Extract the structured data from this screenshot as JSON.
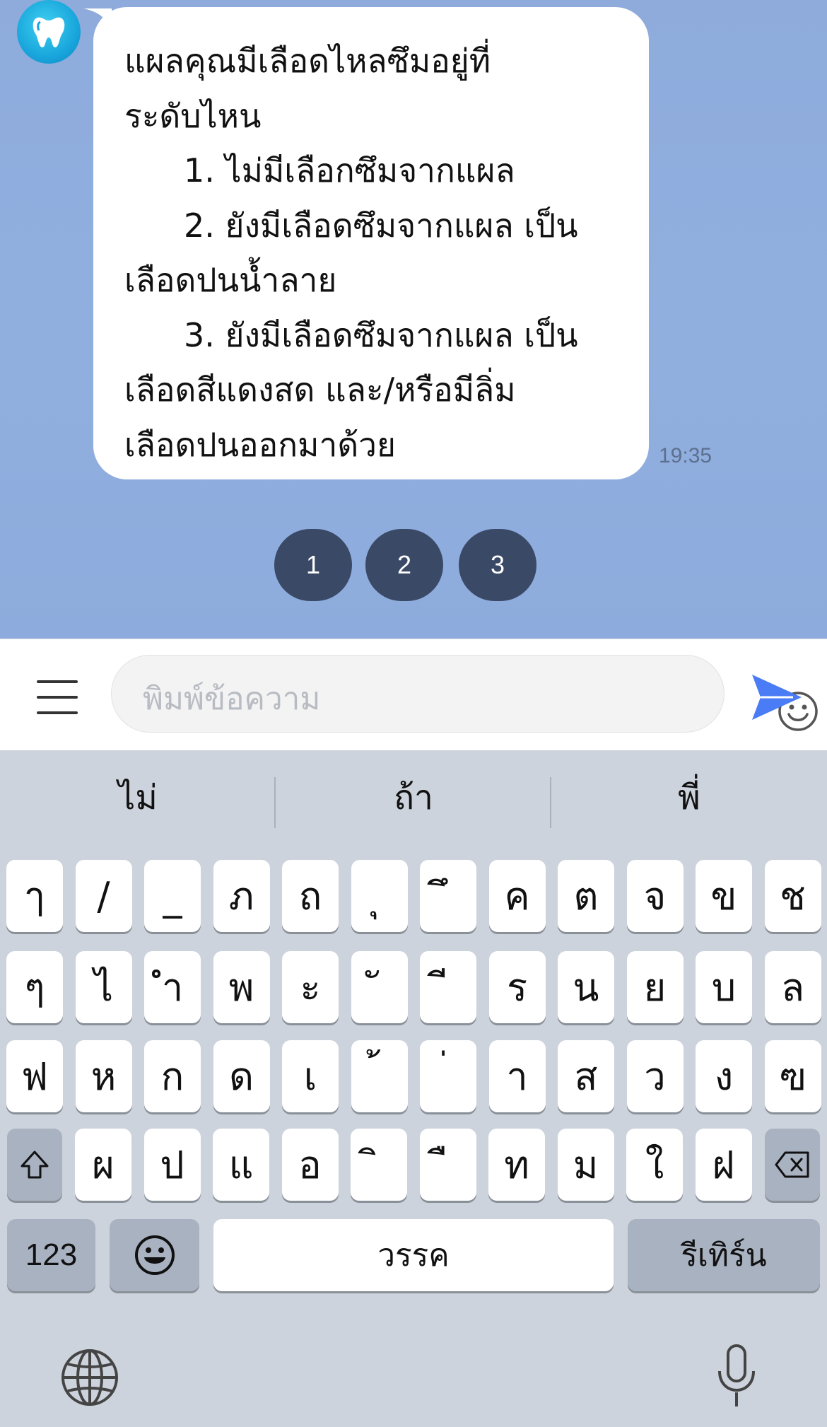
{
  "chat": {
    "message_lines": [
      {
        "text": "แผลคุณมีเลือดไหลซึมอยู่ที่",
        "indent": false
      },
      {
        "text": "ระดับไหน",
        "indent": false
      },
      {
        "text": "1. ไม่มีเลือกซึมจากแผล",
        "indent": true
      },
      {
        "text": "2. ยังมีเลือดซึมจากแผล เป็น",
        "indent": true
      },
      {
        "text": "เลือดปนน้ำลาย",
        "indent": false
      },
      {
        "text": "3. ยังมีเลือดซึมจากแผล เป็น",
        "indent": true
      },
      {
        "text": "เลือดสีแดงสด และ/หรือมีลิ่ม",
        "indent": false
      },
      {
        "text": "เลือดปนออกมาด้วย",
        "indent": false
      }
    ],
    "timestamp": "19:35",
    "quick_replies": [
      "1",
      "2",
      "3"
    ],
    "avatar_icon": "tooth-logo-icon"
  },
  "input": {
    "placeholder": "พิมพ์ข้อความ",
    "menu_icon": "hamburger-menu-icon",
    "emoji_icon": "smiley-icon",
    "send_icon": "send-arrow-icon"
  },
  "keyboard": {
    "suggestions": [
      "ไม่",
      "ถ้า",
      "พี่"
    ],
    "row1": [
      "ๅ",
      "/",
      "_",
      "ภ",
      "ถ",
      "ุ",
      "ึ",
      "ค",
      "ต",
      "จ",
      "ข",
      "ช"
    ],
    "row2": [
      "ๆ",
      "ไ",
      "ำ",
      "พ",
      "ะ",
      "ั",
      "ี",
      "ร",
      "น",
      "ย",
      "บ",
      "ล"
    ],
    "row3": [
      "ฟ",
      "ห",
      "ก",
      "ด",
      "เ",
      "้",
      "่",
      "า",
      "ส",
      "ว",
      "ง",
      "ฃ"
    ],
    "row4": [
      "ผ",
      "ป",
      "แ",
      "อ",
      "ิ",
      "ื",
      "ท",
      "ม",
      "ใ",
      "ฝ"
    ],
    "numbers_label": "123",
    "space_label": "วรรค",
    "return_label": "รีเทิร์น",
    "colors": {
      "key": "#ffffff",
      "dark_key": "#a9b2c1",
      "background": "#cdd3dc"
    }
  },
  "colors": {
    "chat_bg": "#8eabdc",
    "quick_reply": "#3a4966",
    "send": "#4a7cf6"
  }
}
